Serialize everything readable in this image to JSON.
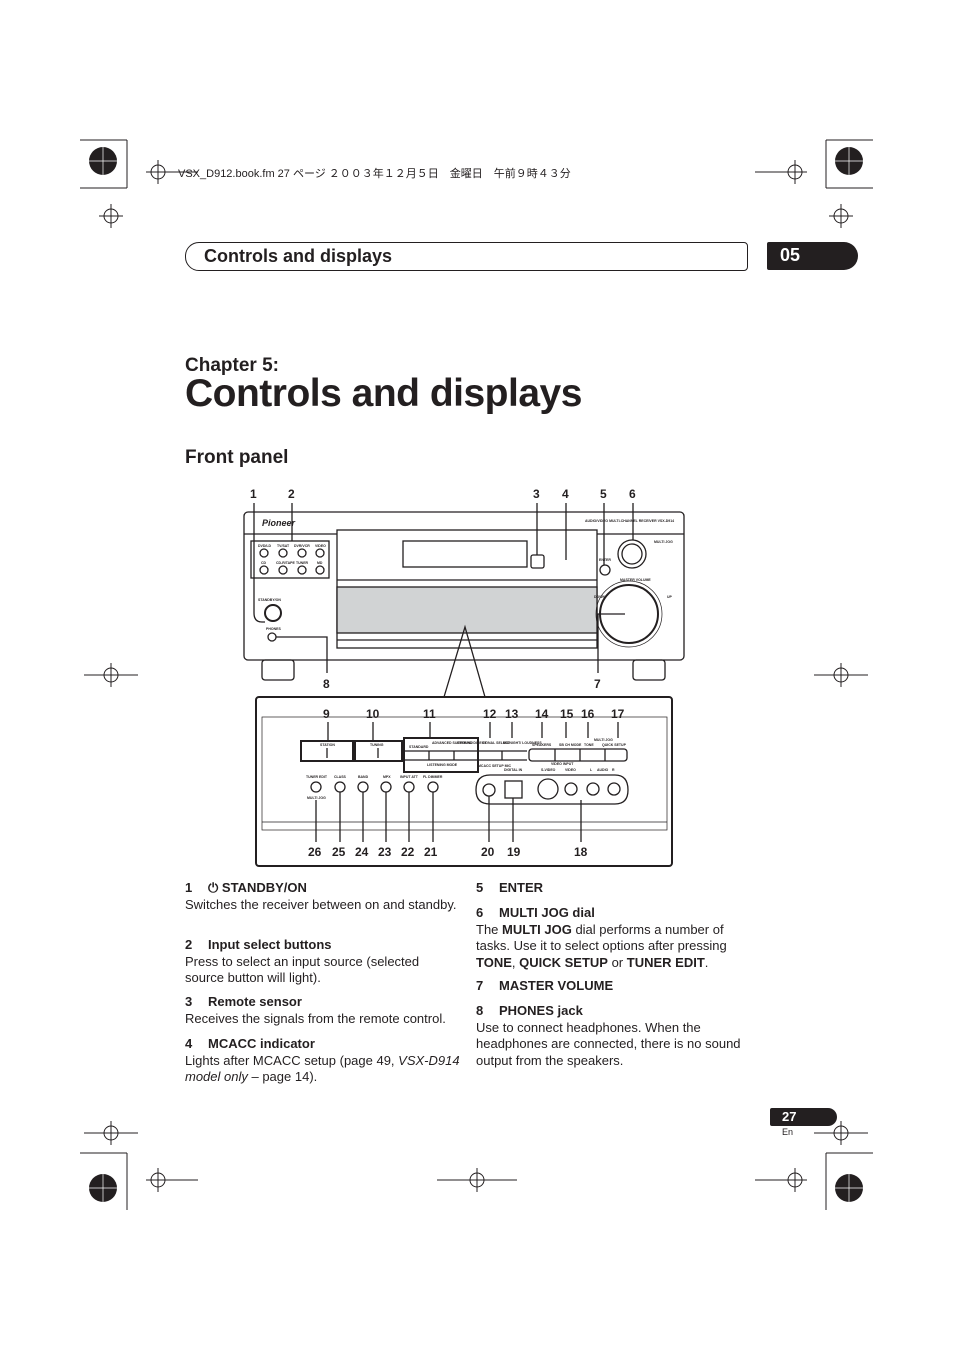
{
  "file_header": "VSX_D912.book.fm  27 ページ  ２００３年１２月５日　金曜日　午前９時４３分",
  "header": {
    "title": "Controls and displays",
    "chapter_number": "05"
  },
  "chapter_label": "Chapter 5:",
  "page_title": "Controls and displays",
  "section_title": "Front panel",
  "diagram": {
    "top_callouts": [
      "1",
      "2",
      "3",
      "4",
      "5",
      "6"
    ],
    "mid_callouts": [
      "8",
      "7"
    ],
    "panel_top_callouts": [
      "9",
      "10",
      "11",
      "12",
      "13",
      "14",
      "15",
      "16",
      "17"
    ],
    "panel_bottom_callouts": [
      "26",
      "25",
      "24",
      "23",
      "22",
      "21",
      "20",
      "19",
      "18"
    ],
    "brand": "Pioneer",
    "model_text": "AUDIO/VIDEO MULTI-CHANNEL RECEIVER VSX-D914",
    "labels": {
      "input_buttons": [
        "DVD/LD",
        "TV/SAT",
        "DVR/VCR",
        "VIDEO",
        "CD",
        "CD-R/TAPE",
        "TUNER",
        "MD"
      ],
      "standby": "STANDBY/ON",
      "phones": "PHONES",
      "multi_jog": "MULTI JOG",
      "enter": "ENTER",
      "master_volume": "MASTER VOLUME",
      "down": "DOWN",
      "up": "UP",
      "station": "STATION",
      "tuning": "TUNING",
      "standard": "STANDARD",
      "advanced_surround": "ADVANCED SURROUND",
      "stereo_direct": "STEREO/ DIRECT",
      "listening_mode": "LISTENING MODE",
      "signal_select": "SIGNAL SELECT",
      "midnight_loudness": "MIDNIGHT/ LOUDNESS",
      "speakers": "SPEAKERS",
      "sb_ch_mode": "SB CH MODE",
      "tone": "TONE",
      "multi_jog_small": "MULTI JOG",
      "quick_setup": "QUICK SETUP",
      "mcacc_setup_mic": "MCACC SETUP MIC",
      "digital_in": "DIGITAL IN",
      "video_input": "VIDEO INPUT",
      "s_video": "S-VIDEO",
      "video": "VIDEO",
      "audio_l": "L",
      "audio": "AUDIO",
      "audio_r": "R",
      "tuner_edit": "TUNER EDIT",
      "multi_jog_under": "MULTI JOG",
      "class": "CLASS",
      "band": "BAND",
      "mpx": "MPX",
      "input_att": "INPUT ATT",
      "fl_dimmer": "FL DIMMER"
    }
  },
  "items_left": [
    {
      "num": "1",
      "heading": "STANDBY/ON",
      "icon": "power-icon",
      "desc": "Switches the receiver between on and standby."
    },
    {
      "num": "2",
      "heading": "Input select buttons",
      "desc": "Press to select an input source (selected source button will light)."
    },
    {
      "num": "3",
      "heading": "Remote sensor",
      "desc": "Receives the signals from the remote control."
    },
    {
      "num": "4",
      "heading": "MCACC indicator",
      "desc": "Lights after MCACC setup (page 49, ",
      "desc_italic": "VSX-D914 model only",
      "desc_end": " – page 14)."
    }
  ],
  "items_right": [
    {
      "num": "5",
      "heading": "ENTER"
    },
    {
      "num": "6",
      "heading": "MULTI JOG dial",
      "desc_parts": [
        "The ",
        "MULTI JOG",
        " dial performs a number of tasks. Use it to select options after pressing ",
        "TONE",
        ", ",
        "QUICK SETUP",
        " or ",
        "TUNER EDIT",
        "."
      ]
    },
    {
      "num": "7",
      "heading": "MASTER VOLUME"
    },
    {
      "num": "8",
      "heading": "PHONES jack",
      "desc": "Use to connect headphones. When the headphones are connected, there is no sound output from the speakers."
    }
  ],
  "footer": {
    "page_number": "27",
    "language": "En"
  }
}
